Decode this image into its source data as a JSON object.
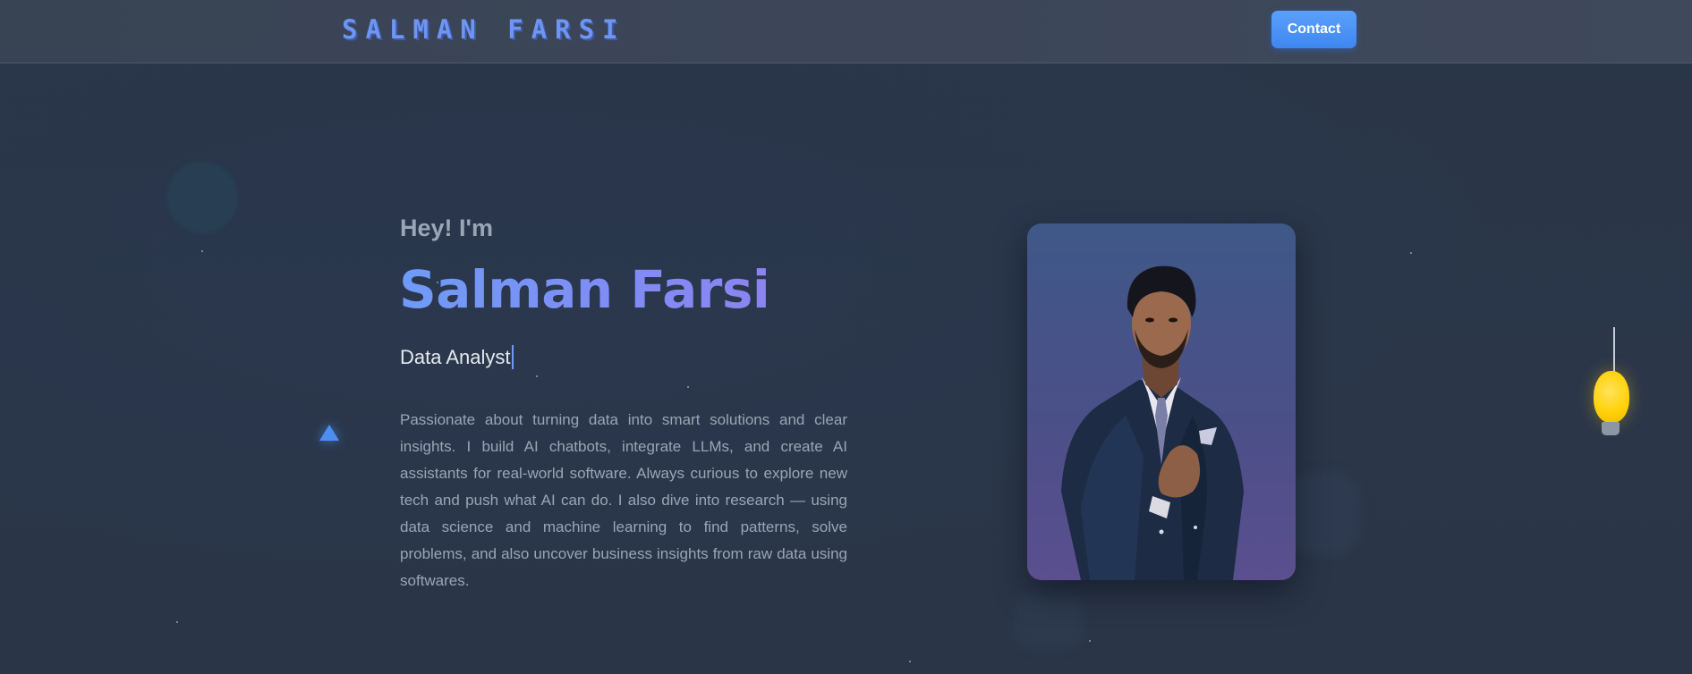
{
  "navbar": {
    "brand": "SALMAN FARSI",
    "contact_label": "Contact"
  },
  "hero": {
    "greeting": "Hey! I'm",
    "name": "Salman Farsi",
    "role": "Data Analyst",
    "bio": "Passionate about turning data into smart solutions and clear insights. I build AI chatbots, integrate LLMs, and create AI assistants for real-world software. Always curious to explore new tech and push what AI can do. I also dive into research — using data science and machine learning to find patterns, solve problems, and also uncover business insights from raw data using softwares."
  },
  "decorations": {
    "icons": [
      "triangle-icon",
      "light-bulb-icon"
    ],
    "bulb_color": "#ffd20a",
    "accent_color": "#4d8ef2"
  },
  "colors": {
    "background": "#263244",
    "navbar": "#3c4658",
    "brand": "#6f95f2",
    "button": "#4a94f6",
    "name_gradient_start": "#6f9bf7",
    "name_gradient_end": "#8c84f0",
    "body_text": "#9aa5b4"
  }
}
